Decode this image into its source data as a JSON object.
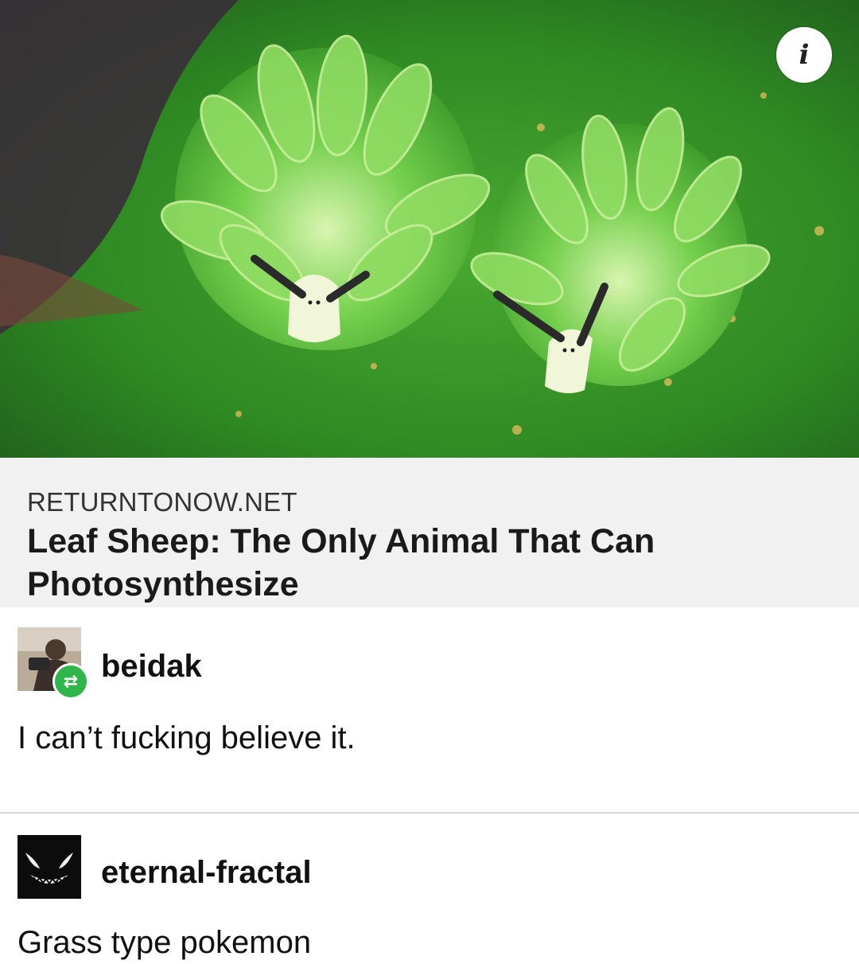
{
  "link_card": {
    "source": "RETURNTONOW.NET",
    "title": "Leaf Sheep: The Only Animal That Can Photosynthesize"
  },
  "info_button": {
    "icon": "info-icon",
    "glyph": "i"
  },
  "posts": [
    {
      "username": "beidak",
      "text": "I can’t fucking believe it.",
      "badge_icon": "reblog-icon",
      "badge_color": "#2fb64b"
    },
    {
      "username": "eternal-fractal",
      "text": "Grass type pokemon"
    }
  ]
}
